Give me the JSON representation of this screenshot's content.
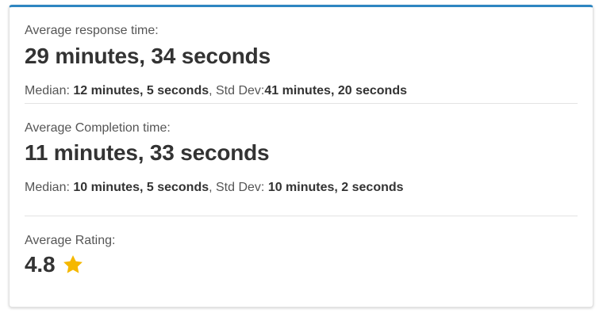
{
  "response": {
    "label": "Average response time:",
    "value": "29 minutes, 34 seconds",
    "median_label": "Median: ",
    "median_value": "12 minutes, 5 seconds",
    "stddev_label": ", Std Dev:",
    "stddev_value": "41 minutes, 20 seconds"
  },
  "completion": {
    "label": "Average Completion time:",
    "value": "11 minutes, 33 seconds",
    "median_label": "Median: ",
    "median_value": "10 minutes, 5 seconds",
    "stddev_label": ", Std Dev: ",
    "stddev_value": "10 minutes, 2 seconds"
  },
  "rating": {
    "label": "Average Rating:",
    "value": "4.8",
    "icon": "star-icon",
    "star_color": "#f5b800"
  },
  "colors": {
    "accent": "#2e86c1"
  }
}
